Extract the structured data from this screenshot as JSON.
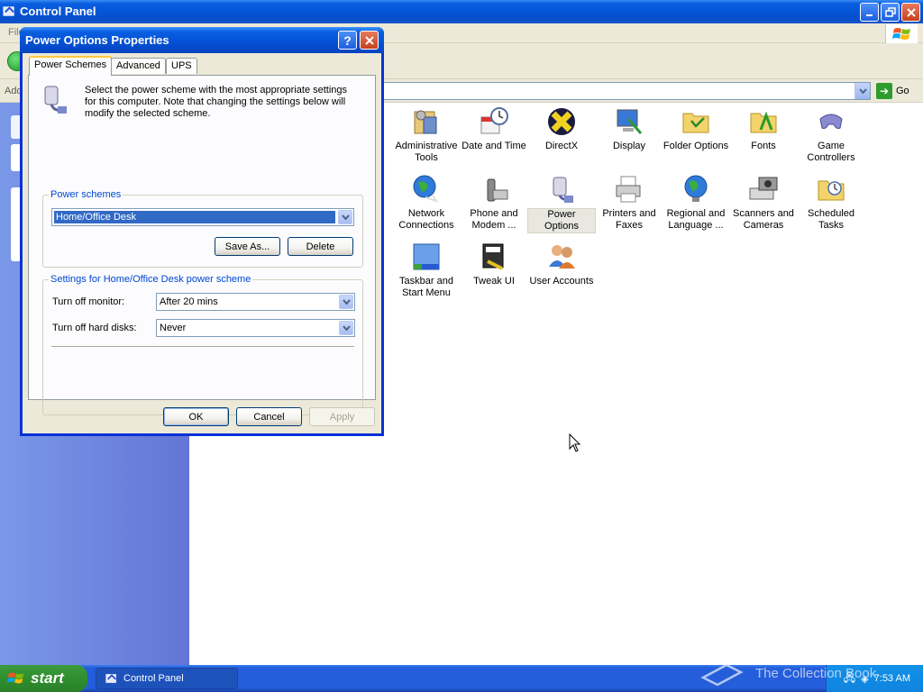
{
  "control_panel": {
    "title": "Control Panel",
    "menu_text": "File",
    "address_label": "Address",
    "go_label": "Go",
    "icons": [
      {
        "name": "administrative-tools",
        "label": "Administrative Tools"
      },
      {
        "name": "date-and-time",
        "label": "Date and Time"
      },
      {
        "name": "directx",
        "label": "DirectX"
      },
      {
        "name": "display",
        "label": "Display"
      },
      {
        "name": "folder-options",
        "label": "Folder Options"
      },
      {
        "name": "fonts",
        "label": "Fonts"
      },
      {
        "name": "game-controllers",
        "label": "Game Controllers"
      },
      {
        "name": "network-connections",
        "label": "Network Connections"
      },
      {
        "name": "phone-and-modem",
        "label": "Phone and Modem ..."
      },
      {
        "name": "power-options",
        "label": "Power Options",
        "selected": true
      },
      {
        "name": "printers-and-faxes",
        "label": "Printers and Faxes"
      },
      {
        "name": "regional-and-language",
        "label": "Regional and Language ..."
      },
      {
        "name": "scanners-and-cameras",
        "label": "Scanners and Cameras"
      },
      {
        "name": "scheduled-tasks",
        "label": "Scheduled Tasks"
      },
      {
        "name": "taskbar-and-start-menu",
        "label": "Taskbar and Start Menu"
      },
      {
        "name": "tweak-ui",
        "label": "Tweak UI"
      },
      {
        "name": "user-accounts",
        "label": "User Accounts"
      }
    ]
  },
  "dialog": {
    "title": "Power Options Properties",
    "tabs": [
      "Power Schemes",
      "Advanced",
      "UPS"
    ],
    "intro": "Select the power scheme with the most appropriate settings for this computer. Note that changing the settings below will modify the selected scheme.",
    "schemes_group": "Power schemes",
    "selected_scheme": "Home/Office Desk",
    "save_as": "Save As...",
    "delete": "Delete",
    "settings_group": "Settings for Home/Office Desk power scheme",
    "monitor_label": "Turn off monitor:",
    "monitor_value": "After 20 mins",
    "disks_label": "Turn off hard disks:",
    "disks_value": "Never",
    "ok": "OK",
    "cancel": "Cancel",
    "apply": "Apply"
  },
  "taskbar": {
    "start_label": "start",
    "task_label": "Control Panel",
    "clock": "7:53 AM"
  },
  "watermark": "The Collection Book",
  "colors": {
    "titlebar_blue": "#0554d8",
    "taskbar_blue": "#245edb",
    "start_green": "#2f8f2f",
    "dialog_face": "#ece9d8",
    "selection": "#316ac5",
    "group_title": "#0046d5"
  }
}
